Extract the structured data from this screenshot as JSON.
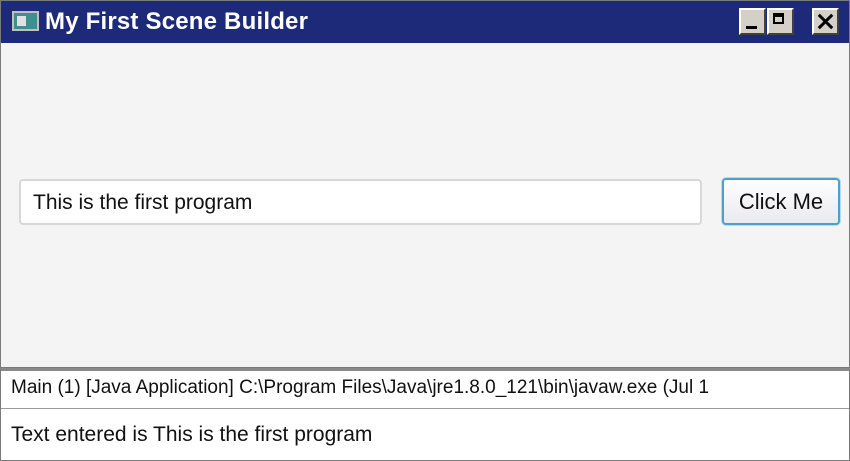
{
  "window": {
    "title": "My First Scene Builder",
    "controls": {
      "minimize_icon": "minimize-icon",
      "maximize_icon": "maximize-icon",
      "close_icon": "close-icon"
    },
    "colors": {
      "titlebar": "#1d2a7a",
      "button_focus": "#4aa0cf"
    }
  },
  "form": {
    "textfield_value": "This is the first program",
    "button_label": "Click Me"
  },
  "console": {
    "header": "Main (1) [Java Application] C:\\Program Files\\Java\\jre1.8.0_121\\bin\\javaw.exe (Jul 1",
    "output": "Text entered is This is the first program"
  }
}
